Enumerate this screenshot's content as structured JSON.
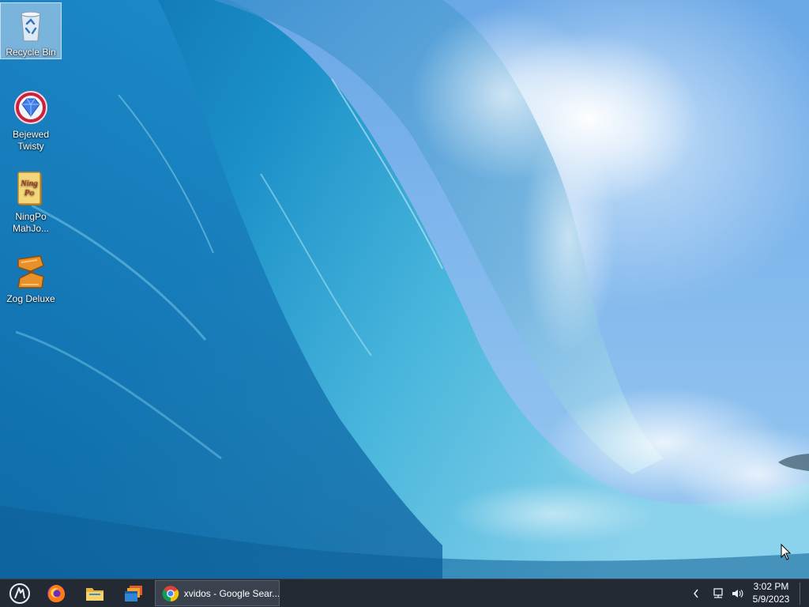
{
  "desktop": {
    "icons": [
      {
        "label": "Recycle Bin",
        "icon": "recycle-bin-icon",
        "selected": true
      },
      {
        "label": "Bejewed Twisty",
        "icon": "gem-icon"
      },
      {
        "label": "NingPo MahJo...",
        "icon": "mahjong-tile-icon"
      },
      {
        "label": "Zog Deluxe",
        "icon": "zog-game-icon"
      }
    ],
    "mahjong_icon_text": "Ning Po"
  },
  "taskbar": {
    "start_icon": "start-menu-icon",
    "pinned": [
      {
        "name": "Firefox",
        "icon": "firefox-icon"
      },
      {
        "name": "File Explorer",
        "icon": "folder-icon"
      },
      {
        "name": "Windows",
        "icon": "windows-stack-icon"
      }
    ],
    "active_task": {
      "label": "xvidos - Google Sear...",
      "icon": "chrome-icon"
    },
    "tray": {
      "overflow_icon": "chevron-left-icon",
      "network_icon": "network-icon",
      "volume_icon": "volume-icon",
      "time": "3:02 PM",
      "date": "5/9/2023"
    }
  },
  "colors": {
    "taskbar_bg": "#232a33",
    "sky": "#7fb6ec",
    "wave_deep": "#0f6fae",
    "wave_light": "#44b4dc"
  }
}
